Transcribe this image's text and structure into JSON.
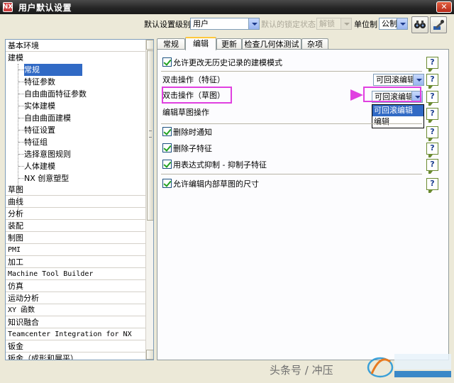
{
  "window": {
    "title": "用户默认设置",
    "close": "✕"
  },
  "toolbar": {
    "level_label": "默认设置级别",
    "level_value": "用户",
    "lock_state_label": "默认的锁定状态",
    "lock_state_value": "解锁",
    "unit_label": "单位制",
    "unit_value": "公制"
  },
  "sidebar": {
    "top_items": [
      "基本环境",
      "建模"
    ],
    "child_items": [
      "常规",
      "特征参数",
      "自由曲面特征参数",
      "实体建模",
      "自由曲面建模",
      "特征设置",
      "特征组",
      "选择意图规则",
      "人体建模",
      "NX 创意塑型"
    ],
    "selected_child": "常规",
    "bottom_items": [
      "草图",
      "曲线",
      "分析",
      "装配",
      "制图",
      "PMI",
      "加工",
      "Machine Tool Builder",
      "仿真",
      "运动分析",
      "XY 函数",
      "知识融合",
      "Teamcenter Integration for NX",
      "钣金",
      "钣金（成形和展平）"
    ]
  },
  "tabs": [
    "常规",
    "编辑",
    "更新",
    "检查几何体测试",
    "杂项"
  ],
  "active_tab": "编辑",
  "panel": {
    "allow_change_label": "允许更改无历史记录的建模模式",
    "double_click_feature_label": "双击操作（特征）",
    "double_click_feature_value": "可回滚编辑",
    "double_click_sketch_label": "双击操作（草图）",
    "double_click_sketch_value": "可回滚编辑",
    "dropdown_options": [
      "可回滚编辑",
      "编辑"
    ],
    "edit_sketch_label": "编辑草图操作",
    "delete_notify_label": "删除时通知",
    "delete_children_label": "删除子特征",
    "expr_suppress_label": "用表达式抑制 - 抑制子特征",
    "allow_edit_dims_label": "允许编辑内部草图的尺寸",
    "help_glyph": "?"
  },
  "annotation": {
    "color": "#e040e0"
  },
  "watermark": {
    "text": "头条号 / 冲压"
  }
}
